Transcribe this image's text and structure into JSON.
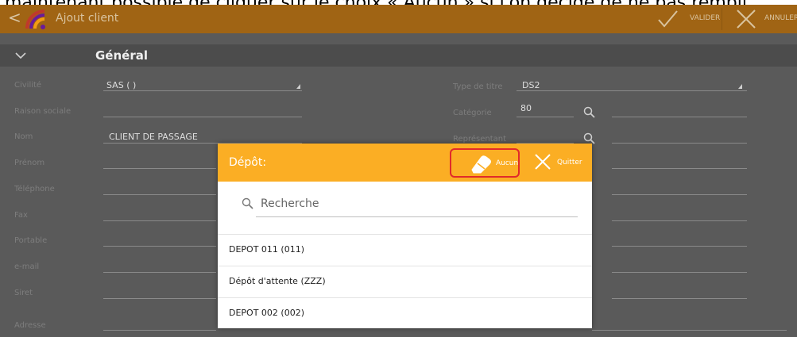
{
  "caption": "maintenant possible de cliquer sur le choix « Aucun » si l'on décide de ne pas rempli",
  "topbar": {
    "back": "<",
    "title": "Ajout client",
    "valider": "VALIDER",
    "annuler": "ANNULER"
  },
  "section": {
    "title": "Général"
  },
  "form": {
    "labels": [
      "Civilité",
      "Raison sociale",
      "Nom",
      "Prénom",
      "Téléphone",
      "Fax",
      "Portable",
      "e-mail",
      "Siret",
      "Adresse"
    ],
    "civilite_value": "SAS ( )",
    "nom_value": "CLIENT DE PASSAGE",
    "right_labels": [
      "Type de titre",
      "Catégorie",
      "Représentant"
    ],
    "type_de_titre_value": "DS2",
    "categorie_value": "80"
  },
  "dialog": {
    "title": "Dépôt:",
    "aucun_label": "Aucun",
    "quitter_label": "Quitter",
    "search_placeholder": "Recherche",
    "items": [
      {
        "label": "DEPOT 011  (011)"
      },
      {
        "label": "Dépôt d'attente  (ZZZ)"
      },
      {
        "label": "DEPOT 002  (002)"
      }
    ]
  },
  "colors": {
    "topbar": "#a06414",
    "dialog_header": "#fbae24",
    "highlight": "#e12a2a",
    "background": "#5a5a5a"
  }
}
